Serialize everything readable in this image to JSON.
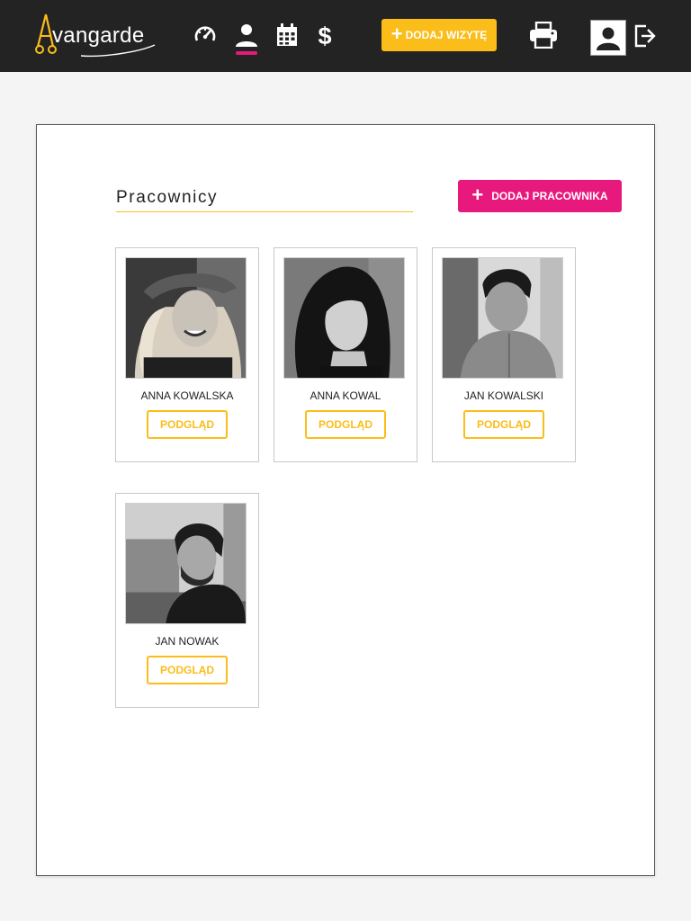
{
  "app": {
    "logo_text": "vangarde",
    "logo_icon": "scissors-a-icon"
  },
  "nav": {
    "items": [
      {
        "name": "dashboard",
        "icon": "speedometer-icon",
        "active": false
      },
      {
        "name": "employees",
        "icon": "person-icon",
        "active": true
      },
      {
        "name": "calendar",
        "icon": "calendar-icon",
        "active": false
      },
      {
        "name": "finance",
        "icon": "dollar-icon",
        "active": false
      }
    ],
    "add_visit_label": "DODAJ WIZYTĘ",
    "print_icon": "printer-icon",
    "account_icon": "account-icon",
    "logout_icon": "logout-icon"
  },
  "page": {
    "title": "Pracownicy",
    "add_employee_label": "DODAJ PRACOWNIKA"
  },
  "employees": [
    {
      "name": "ANNA KOWALSKA",
      "button": "PODGLĄD"
    },
    {
      "name": "ANNA KOWAL",
      "button": "PODGLĄD"
    },
    {
      "name": "JAN KOWALSKI",
      "button": "PODGLĄD"
    },
    {
      "name": "JAN NOWAK",
      "button": "PODGLĄD"
    }
  ],
  "colors": {
    "topbar": "#232323",
    "accent_yellow": "#fbbd19",
    "accent_pink": "#e8197d",
    "background": "#f4f4f4"
  }
}
